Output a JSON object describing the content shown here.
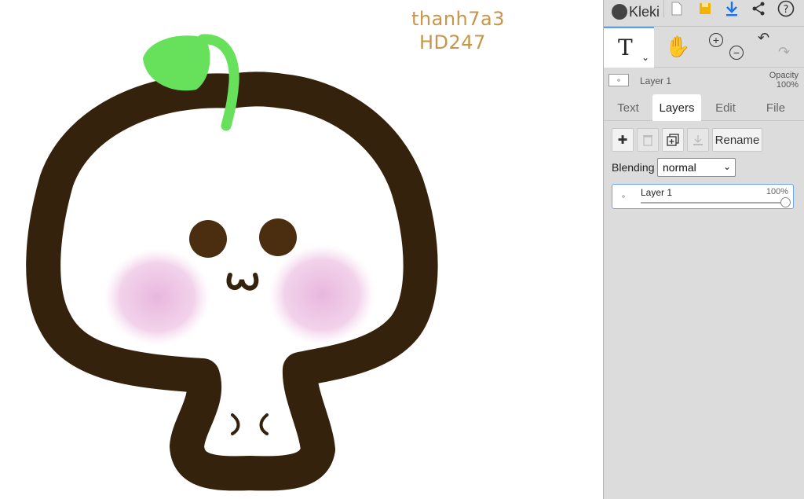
{
  "app": {
    "name": "Kleki"
  },
  "canvas": {
    "signature_line1": "thanh7a3",
    "signature_line2": "HD247",
    "drawing_colors": {
      "outline": "#34220d",
      "eyes": "#4b2d0f",
      "blush": "#e9b7dd",
      "sprout": "#67e05b"
    }
  },
  "topbar": {
    "icons": [
      "new-file-icon",
      "save-icon",
      "download-icon",
      "share-icon",
      "help-icon"
    ]
  },
  "tools": {
    "active_tool": "T",
    "caret": "⌄",
    "hand_glyph": "✋",
    "zoom_in": "+",
    "zoom_out": "−",
    "undo": "↶",
    "redo": "↷"
  },
  "layer_preview": {
    "name": "Layer 1",
    "opacity_label": "Opacity",
    "opacity_value": "100%"
  },
  "tabs": [
    {
      "label": "Text",
      "active": false
    },
    {
      "label": "Layers",
      "active": true
    },
    {
      "label": "Edit",
      "active": false
    },
    {
      "label": "File",
      "active": false
    }
  ],
  "layers_pane": {
    "add": "✚",
    "delete": "🗑",
    "duplicate": "⧉",
    "merge": "⤓",
    "rename_label": "Rename",
    "blending_label": "Blending",
    "blending_value": "normal",
    "layers": [
      {
        "name": "Layer 1",
        "opacity": "100%",
        "opacity_fraction": 1.0
      }
    ]
  },
  "accent_color": "#5aa0e0"
}
